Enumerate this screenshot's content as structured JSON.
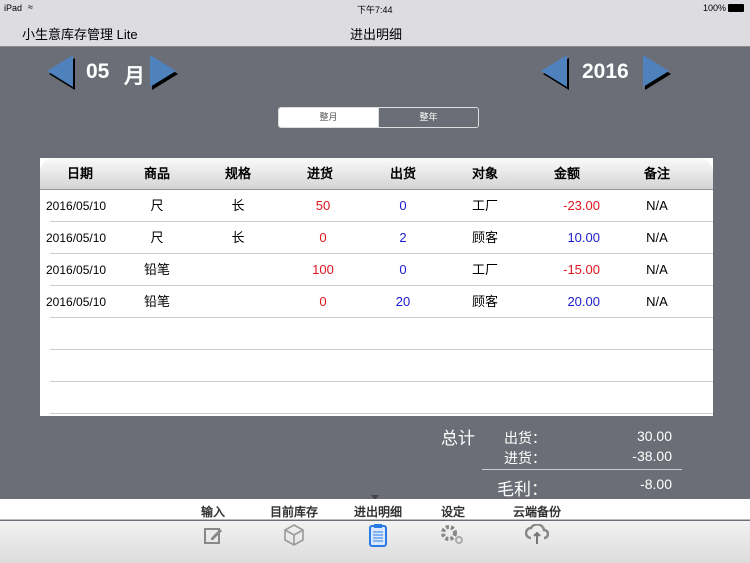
{
  "status": {
    "device": "iPad",
    "time": "下午7:44",
    "battery": "100%"
  },
  "nav": {
    "app_title": "小生意库存管理 Lite",
    "title": "进出明细"
  },
  "month": {
    "value": "05",
    "unit": "月"
  },
  "year": {
    "value": "2016"
  },
  "segment": {
    "options": [
      "整月",
      "整年"
    ],
    "selected": 0
  },
  "table": {
    "headers": [
      "日期",
      "商品",
      "规格",
      "进货",
      "出货",
      "对象",
      "金额",
      "备注"
    ],
    "rows": [
      [
        "2016/05/10",
        "尺",
        "长",
        "50",
        "0",
        "工厂",
        "-23.00",
        "N/A"
      ],
      [
        "2016/05/10",
        "尺",
        "长",
        "0",
        "2",
        "顾客",
        "10.00",
        "N/A"
      ],
      [
        "2016/05/10",
        "铅笔",
        "",
        "100",
        "0",
        "工厂",
        "-15.00",
        "N/A"
      ],
      [
        "2016/05/10",
        "铅笔",
        "",
        "0",
        "20",
        "顾客",
        "20.00",
        "N/A"
      ]
    ]
  },
  "totals": {
    "label": "总计",
    "out_label": "出货：",
    "out_value": "30.00",
    "in_label": "进货：",
    "in_value": "-38.00",
    "profit_label": "毛利：",
    "profit_value": "-8.00"
  },
  "tabs": [
    {
      "label": "输入",
      "icon": "edit-icon"
    },
    {
      "label": "目前库存",
      "icon": "box-icon"
    },
    {
      "label": "进出明细",
      "icon": "clipboard-icon"
    },
    {
      "label": "设定",
      "icon": "gear-icon"
    },
    {
      "label": "云端备份",
      "icon": "cloud-sync-icon"
    }
  ],
  "active_tab": 2,
  "colors": {
    "accent": "#4f81bd",
    "negative": "#e0141e",
    "positive": "#1a1ad0"
  }
}
